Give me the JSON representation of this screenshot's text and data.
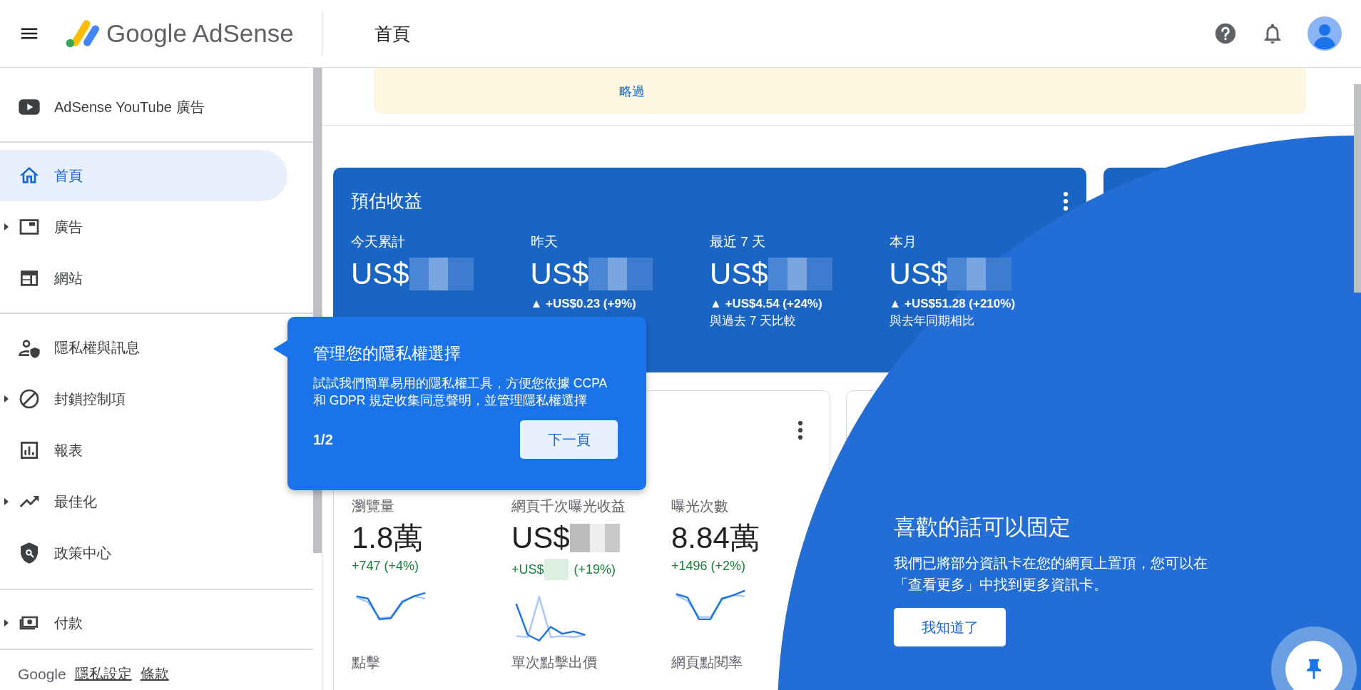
{
  "header": {
    "brand": "Google AdSense",
    "page_title": "首頁"
  },
  "sidebar": {
    "groups": [
      {
        "items": [
          {
            "label": "AdSense YouTube 廣告",
            "selected": false,
            "expandable": false
          }
        ]
      },
      {
        "items": [
          {
            "label": "首頁",
            "selected": true,
            "expandable": false
          },
          {
            "label": "廣告",
            "selected": false,
            "expandable": true
          },
          {
            "label": "網站",
            "selected": false,
            "expandable": false
          }
        ]
      },
      {
        "items": [
          {
            "label": "隱私權與訊息",
            "selected": false,
            "expandable": false
          },
          {
            "label": "封鎖控制項",
            "selected": false,
            "expandable": true
          },
          {
            "label": "報表",
            "selected": false,
            "expandable": false
          },
          {
            "label": "最佳化",
            "selected": false,
            "expandable": true
          },
          {
            "label": "政策中心",
            "selected": false,
            "expandable": false
          }
        ]
      },
      {
        "items": [
          {
            "label": "付款",
            "selected": false,
            "expandable": true
          }
        ]
      }
    ],
    "footer": {
      "brand": "Google",
      "links": [
        "隱私設定",
        "條款"
      ]
    }
  },
  "banner": {
    "link": "略過"
  },
  "earnings": {
    "title": "預估收益",
    "columns": [
      {
        "label": "今天累計",
        "amount": "US$",
        "redacted": true
      },
      {
        "label": "昨天",
        "amount": "US$",
        "redacted": true,
        "change": "▲ +US$0.23 (+9%)"
      },
      {
        "label": "最近 7 天",
        "amount": "US$",
        "redacted": true,
        "change": "▲ +US$4.54 (+24%)",
        "note": "與過去 7 天比較"
      },
      {
        "label": "本月",
        "amount": "US$",
        "redacted": true,
        "change": "▲ +US$51.28 (+210%)",
        "note": "與去年同期相比"
      }
    ]
  },
  "performance": {
    "metrics": [
      {
        "label": "瀏覽量",
        "value": "1.8萬",
        "redacted": false,
        "change": "+747 (+4%)"
      },
      {
        "label": "網頁千次曝光收益",
        "value": "US$",
        "redacted": true,
        "change": "+US$",
        "change_redacted": true,
        "change_suffix": "(+19%)"
      },
      {
        "label": "曝光次數",
        "value": "8.84萬",
        "redacted": false,
        "change": "+1496 (+2%)"
      },
      {
        "label": "點擊"
      },
      {
        "label": "單次點擊出價"
      },
      {
        "label": "網頁點閱率"
      }
    ]
  },
  "tooltip": {
    "title": "管理您的隱私權選擇",
    "body": "試試我們簡單易用的隱私權工具，方便您依據 CCPA 和 GDPR 規定收集同意聲明，並管理隱私權選擇",
    "step": "1/2",
    "button": "下一頁"
  },
  "pin_promo": {
    "title": "喜歡的話可以固定",
    "body": [
      "我們已將部分資訊卡在您的網頁上置頂，您可以在",
      "「查看更多」中找到更多資訊卡。"
    ],
    "button": "我知道了"
  }
}
